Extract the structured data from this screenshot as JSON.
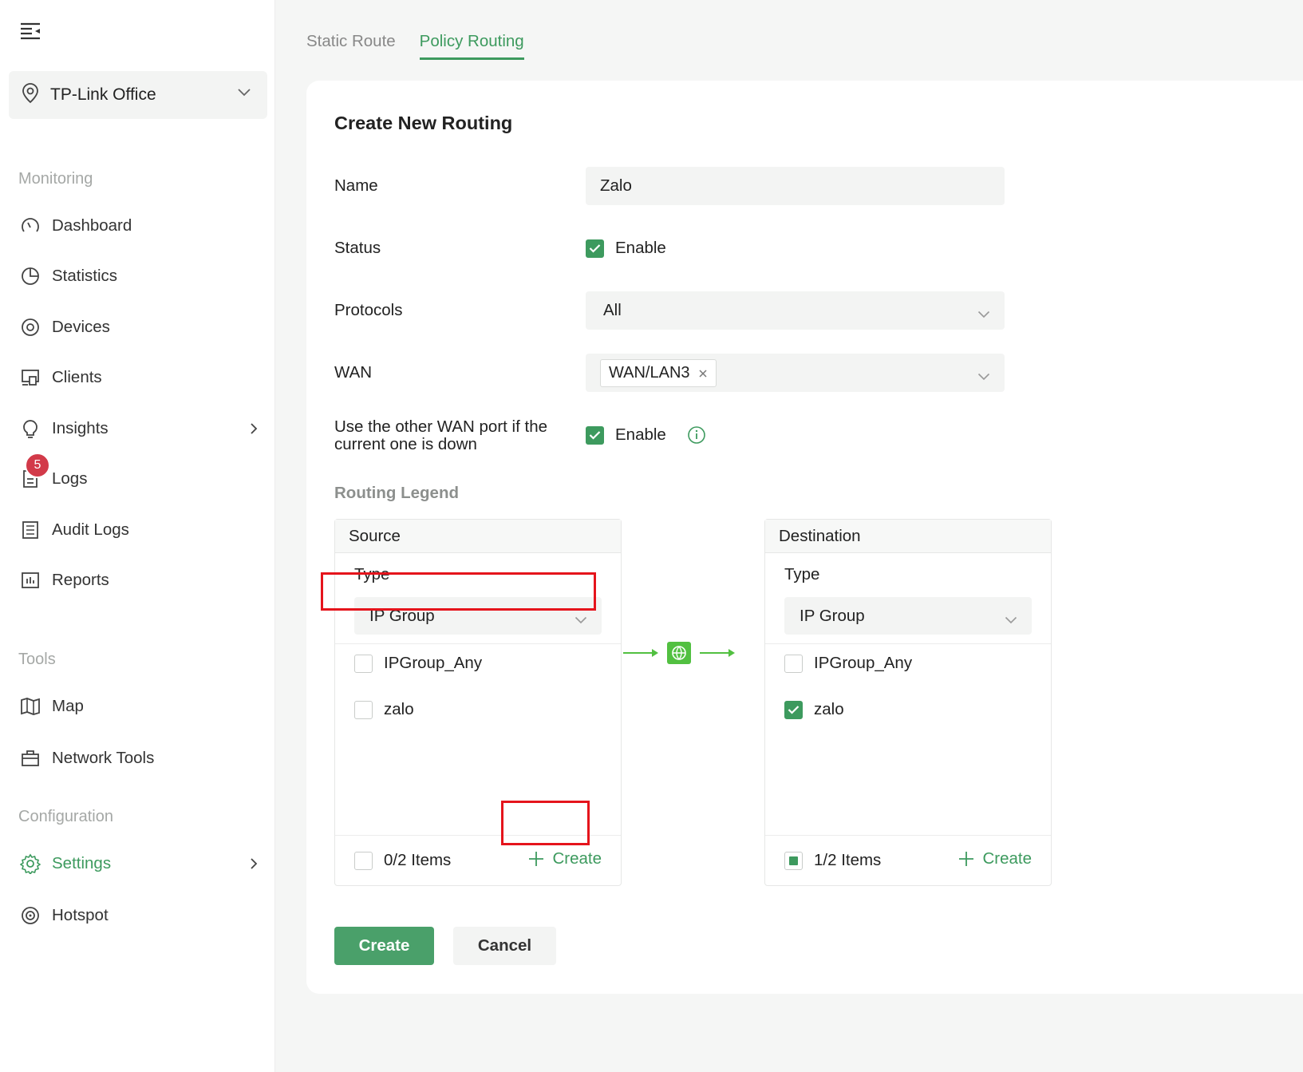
{
  "sidebar": {
    "site": "TP-Link Office",
    "sections": {
      "monitoring": "Monitoring",
      "tools": "Tools",
      "configuration": "Configuration"
    },
    "items": {
      "dashboard": "Dashboard",
      "statistics": "Statistics",
      "devices": "Devices",
      "clients": "Clients",
      "insights": "Insights",
      "logs": "Logs",
      "logs_badge": "5",
      "audit_logs": "Audit Logs",
      "reports": "Reports",
      "map": "Map",
      "network_tools": "Network Tools",
      "settings": "Settings",
      "hotspot": "Hotspot"
    },
    "accent_color": "#3d9a5e",
    "badge_color": "#d23a49"
  },
  "tabs": {
    "static_route": "Static Route",
    "policy_routing": "Policy Routing",
    "active": "Policy Routing"
  },
  "form": {
    "title": "Create New Routing",
    "name_label": "Name",
    "name_value": "Zalo",
    "status_label": "Status",
    "status_enable": "Enable",
    "status_checked": true,
    "protocols_label": "Protocols",
    "protocols_value": "All",
    "wan_label": "WAN",
    "wan_tag": "WAN/LAN3",
    "failover_label_line1": "Use the other WAN port if the",
    "failover_label_line2": "current one is down",
    "failover_enable": "Enable",
    "failover_checked": true,
    "legend_title": "Routing Legend"
  },
  "source": {
    "title": "Source",
    "type_label": "Type",
    "type_value": "IP Group",
    "items": [
      {
        "label": "IPGroup_Any",
        "checked": false
      },
      {
        "label": "zalo",
        "checked": false
      }
    ],
    "count": "0/2 Items",
    "create": "Create"
  },
  "destination": {
    "title": "Destination",
    "type_label": "Type",
    "type_value": "IP Group",
    "items": [
      {
        "label": "IPGroup_Any",
        "checked": false
      },
      {
        "label": "zalo",
        "checked": true
      }
    ],
    "count": "1/2 Items",
    "create": "Create"
  },
  "actions": {
    "create": "Create",
    "cancel": "Cancel"
  },
  "highlight_color": "#e5141c"
}
